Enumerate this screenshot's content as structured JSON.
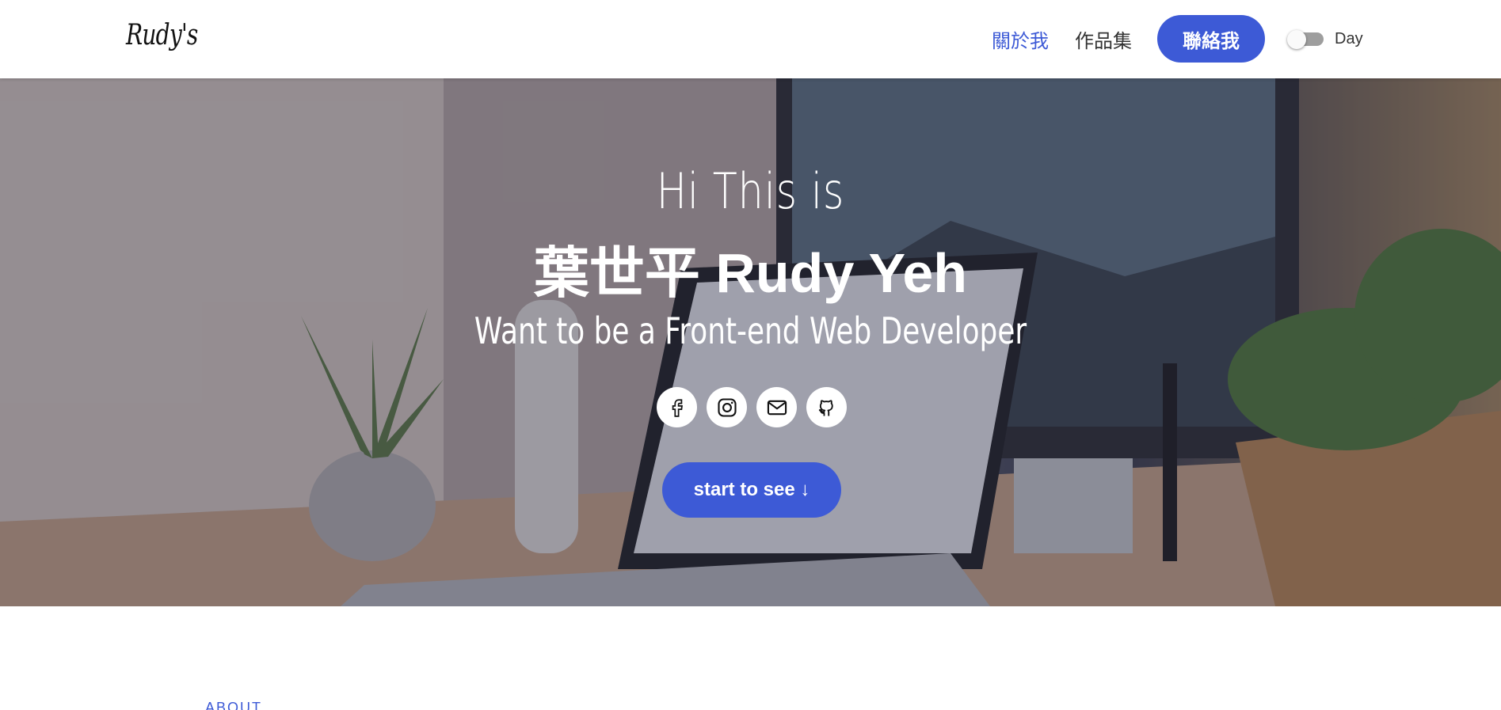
{
  "header": {
    "brand": "Rudy's",
    "nav": {
      "about": "關於我",
      "works": "作品集",
      "contact": "聯絡我"
    },
    "theme_toggle": {
      "label": "Day",
      "state": "off"
    }
  },
  "hero": {
    "greeting": "Hi This is",
    "name": "葉世平 Rudy Yeh",
    "tagline": "Want to be a Front-end Web Developer",
    "socials": [
      {
        "icon": "facebook-icon"
      },
      {
        "icon": "instagram-icon"
      },
      {
        "icon": "mail-icon"
      },
      {
        "icon": "github-icon"
      }
    ],
    "cta": "start to see ↓"
  },
  "about": {
    "section_label": "ABOUT"
  },
  "colors": {
    "accent": "#3d5ad6",
    "text_dark": "#333333",
    "white": "#ffffff"
  }
}
